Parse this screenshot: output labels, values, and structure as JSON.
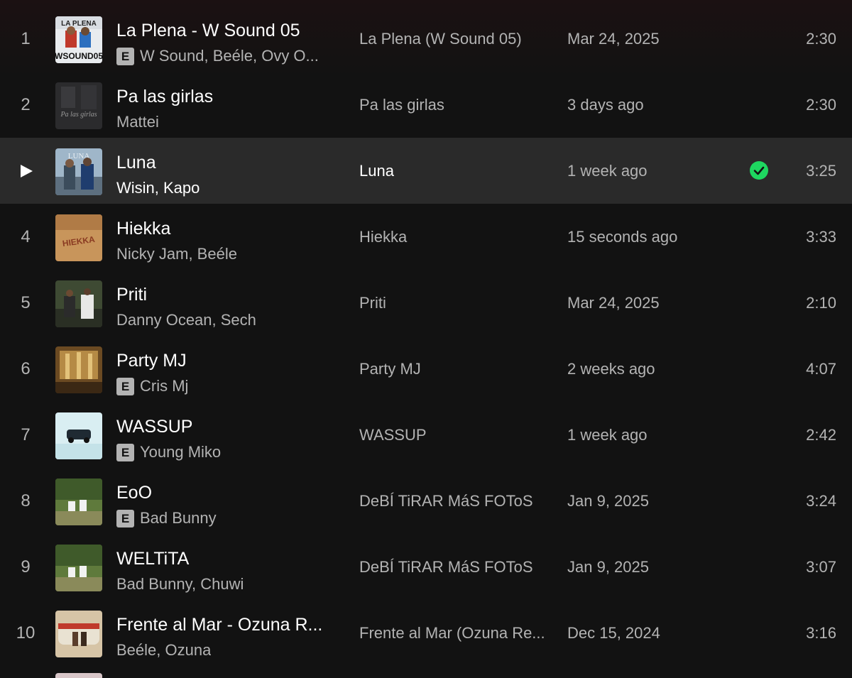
{
  "tracks": [
    {
      "num": "1",
      "title": "La Plena - W Sound 05",
      "explicit": true,
      "artists": "W Sound, Beéle, Ovy O...",
      "album": "La Plena (W Sound 05)",
      "added": "Mar 24, 2025",
      "duration": "2:30",
      "art_text": "WSOUND05",
      "art_top": "LA PLENA"
    },
    {
      "num": "2",
      "title": "Pa las girlas",
      "explicit": false,
      "artists": "Mattei",
      "album": "Pa las girlas",
      "added": "3 days ago",
      "duration": "2:30",
      "art_text": "Pa las girlas"
    },
    {
      "num": "3",
      "title": "Luna",
      "explicit": false,
      "artists": "Wisin, Kapo",
      "album": "Luna",
      "added": "1 week ago",
      "duration": "3:25",
      "art_text": "LUNA",
      "playing": true,
      "saved": true
    },
    {
      "num": "4",
      "title": "Hiekka",
      "explicit": false,
      "artists": "Nicky Jam, Beéle",
      "album": "Hiekka",
      "added": "15 seconds ago",
      "duration": "3:33",
      "art_text": "HIEKKA"
    },
    {
      "num": "5",
      "title": "Priti",
      "explicit": false,
      "artists": "Danny Ocean, Sech",
      "album": "Priti",
      "added": "Mar 24, 2025",
      "duration": "2:10"
    },
    {
      "num": "6",
      "title": "Party MJ",
      "explicit": true,
      "artists": "Cris Mj",
      "album": "Party MJ",
      "added": "2 weeks ago",
      "duration": "4:07"
    },
    {
      "num": "7",
      "title": "WASSUP",
      "explicit": true,
      "artists": "Young Miko",
      "album": "WASSUP",
      "added": "1 week ago",
      "duration": "2:42"
    },
    {
      "num": "8",
      "title": "EoO",
      "explicit": true,
      "artists": "Bad Bunny",
      "album": "DeBÍ TiRAR MáS FOToS",
      "added": "Jan 9, 2025",
      "duration": "3:24"
    },
    {
      "num": "9",
      "title": "WELTiTA",
      "explicit": false,
      "artists": "Bad Bunny, Chuwi",
      "album": "DeBÍ TiRAR MáS FOToS",
      "added": "Jan 9, 2025",
      "duration": "3:07"
    },
    {
      "num": "10",
      "title": "Frente al Mar - Ozuna R...",
      "explicit": false,
      "artists": "Beéle, Ozuna",
      "album": "Frente al Mar (Ozuna Re...",
      "added": "Dec 15, 2024",
      "duration": "3:16"
    }
  ],
  "explicit_label": "E",
  "colors": {
    "background": "#121212",
    "active_row": "#2a2a2a",
    "accent_green": "#1ed760",
    "secondary_text": "#b3b3b3"
  },
  "icons": {
    "play": "play-icon",
    "saved": "check-circle-icon"
  }
}
